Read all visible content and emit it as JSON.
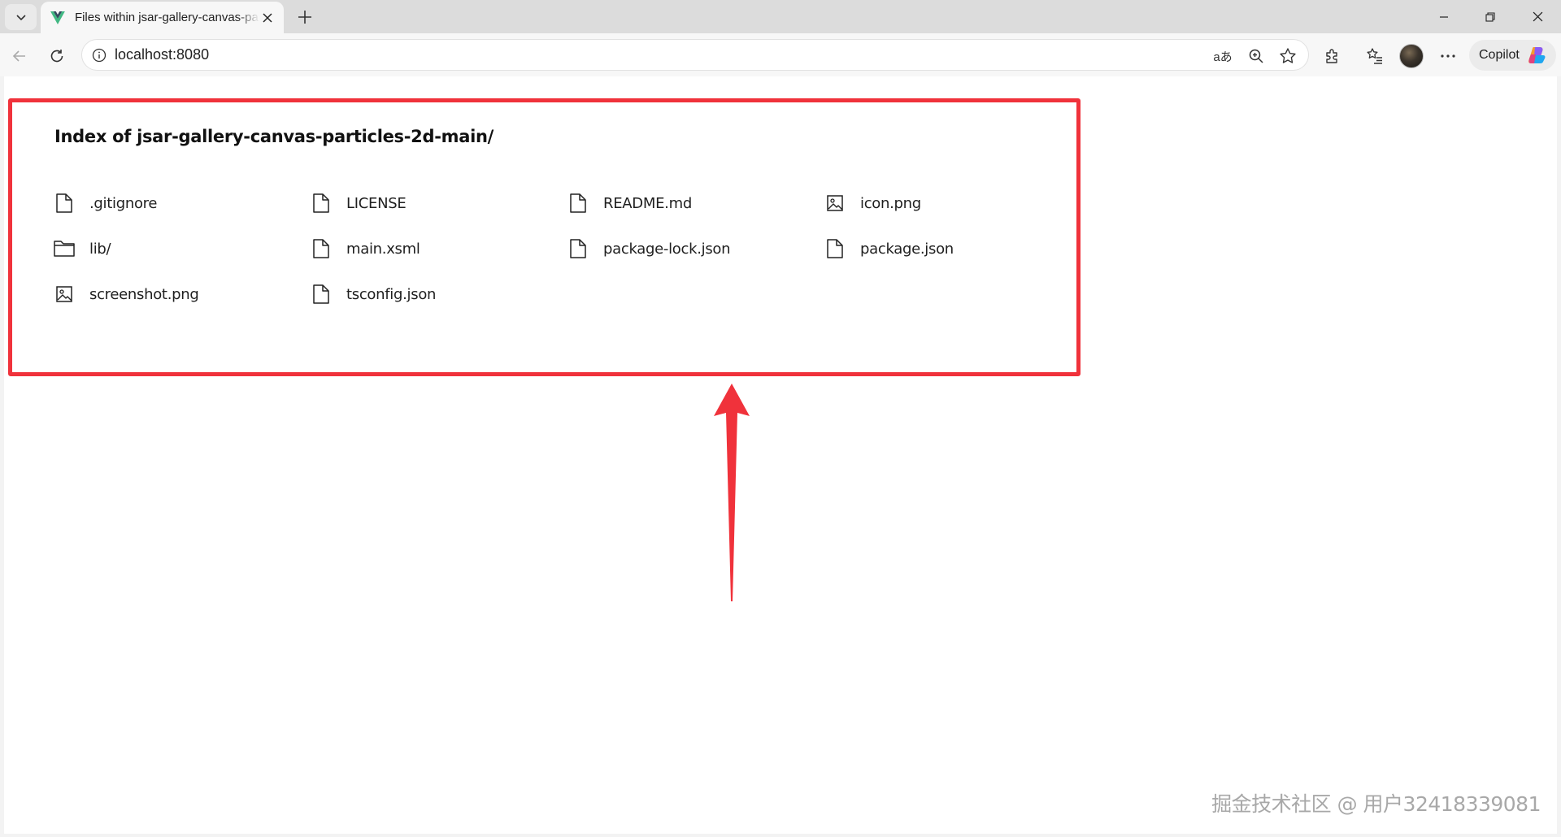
{
  "browser": {
    "tab_title": "Files within jsar-gallery-canvas-pa",
    "url": "localhost:8080",
    "copilot_label": "Copilot",
    "read_aloud_glyph": "aあ"
  },
  "page": {
    "heading": "Index of  jsar-gallery-canvas-particles-2d-main/",
    "files": [
      {
        "name": ".gitignore",
        "icon": "file-icon"
      },
      {
        "name": "LICENSE",
        "icon": "file-icon"
      },
      {
        "name": "README.md",
        "icon": "file-icon"
      },
      {
        "name": "icon.png",
        "icon": "image-icon"
      },
      {
        "name": "lib/",
        "icon": "folder-icon"
      },
      {
        "name": "main.xsml",
        "icon": "file-icon"
      },
      {
        "name": "package-lock.json",
        "icon": "file-icon"
      },
      {
        "name": "package.json",
        "icon": "file-icon"
      },
      {
        "name": "screenshot.png",
        "icon": "image-icon"
      },
      {
        "name": "tsconfig.json",
        "icon": "file-icon"
      }
    ]
  },
  "annotation": {
    "highlight_color": "#f0323b",
    "arrow_color": "#f0323b"
  },
  "watermark": "掘金技术社区 @ 用户32418339081"
}
